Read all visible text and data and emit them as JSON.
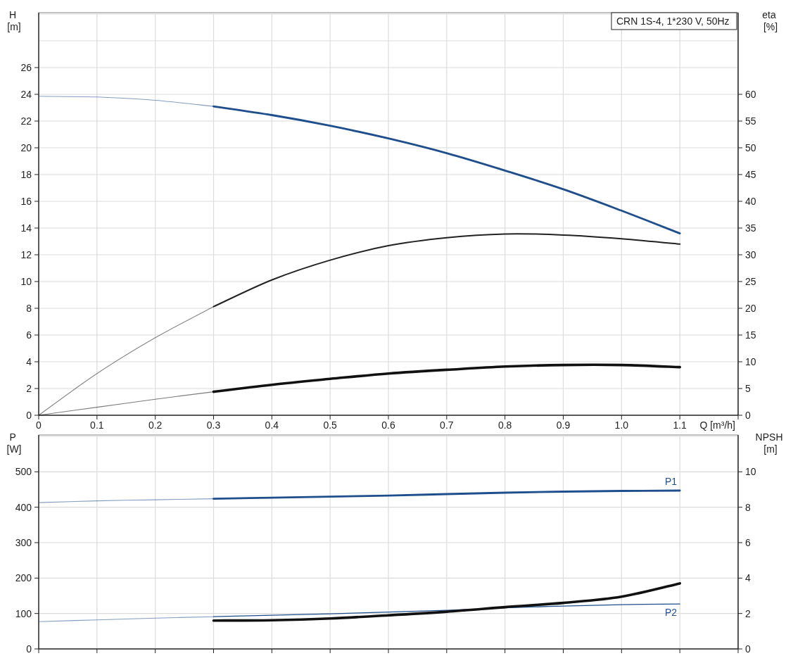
{
  "charts": [
    {
      "chart_data": {
        "type": "line",
        "grid": true,
        "title": "CRN 1S-4, 1*230 V, 50Hz",
        "xlabel": "Q [m³/h]",
        "ylabel": "H [m]",
        "y2label": "eta [%]",
        "xlim": [
          0,
          1.2
        ],
        "ylim": [
          0,
          30
        ],
        "y2lim": [
          0,
          75
        ],
        "xticks": [
          0,
          0.1,
          0.2,
          0.3,
          0.4,
          0.5,
          0.6,
          0.7,
          0.8,
          0.9,
          {
            "value": 1.0,
            "label": "1.0"
          },
          1.1
        ],
        "yticks": [
          0,
          2,
          4,
          6,
          8,
          10,
          12,
          14,
          16,
          18,
          20,
          22,
          24,
          26
        ],
        "y2ticks": [
          0,
          5,
          10,
          15,
          20,
          25,
          30,
          35,
          40,
          45,
          50,
          55,
          60
        ],
        "x": [
          0,
          0.1,
          0.2,
          0.3,
          0.4,
          0.5,
          0.6,
          0.7,
          0.8,
          0.9,
          1.0,
          1.1
        ],
        "series": [
          {
            "color": "#1f4e8c",
            "values": [
              23.85,
              23.8,
              23.55,
              23.1,
              22.45,
              21.65,
              20.7,
              19.6,
              18.3,
              16.9,
              15.3,
              13.6
            ]
          },
          {
            "axis": "y2",
            "color": "#222222",
            "values": [
              0,
              7.8,
              14.5,
              20.3,
              25.3,
              29,
              31.7,
              33.2,
              33.9,
              33.7,
              33,
              32
            ]
          },
          {
            "axis": "y2",
            "color": "#111111",
            "values": [
              0,
              1.5,
              3.0,
              4.4,
              5.7,
              6.8,
              7.8,
              8.5,
              9.1,
              9.4,
              9.4,
              9.0
            ]
          }
        ]
      }
    },
    {
      "chart_data": {
        "type": "line",
        "grid": true,
        "ylabel": "P [W]",
        "y2label": "NPSH [m]",
        "xlim": [
          0,
          1.2
        ],
        "ylim": [
          0,
          600
        ],
        "y2lim": [
          0,
          12
        ],
        "yticks": [
          0,
          100,
          200,
          300,
          400,
          500
        ],
        "y2ticks": [
          0,
          2,
          4,
          6,
          8,
          10
        ],
        "x": [
          0,
          0.1,
          0.2,
          0.3,
          0.4,
          0.5,
          0.6,
          0.7,
          0.8,
          0.9,
          1.0,
          1.1
        ],
        "series": [
          {
            "name": "P1",
            "color": "#1f4e8c",
            "values": [
              413,
              418,
              421,
              424,
              427,
              430,
              433,
              437,
              441,
              444,
              446,
              447
            ]
          },
          {
            "name": "P2",
            "color": "#1f4e8c",
            "values": [
              77,
              82,
              87,
              91,
              95,
              99,
              104,
              109,
              116,
              121,
              125,
              127
            ]
          },
          {
            "axis": "y2",
            "color": "#111111",
            "values": [
              null,
              null,
              null,
              1.6,
              1.62,
              1.72,
              1.9,
              2.1,
              2.36,
              2.6,
              2.95,
              3.7
            ]
          }
        ]
      }
    }
  ]
}
